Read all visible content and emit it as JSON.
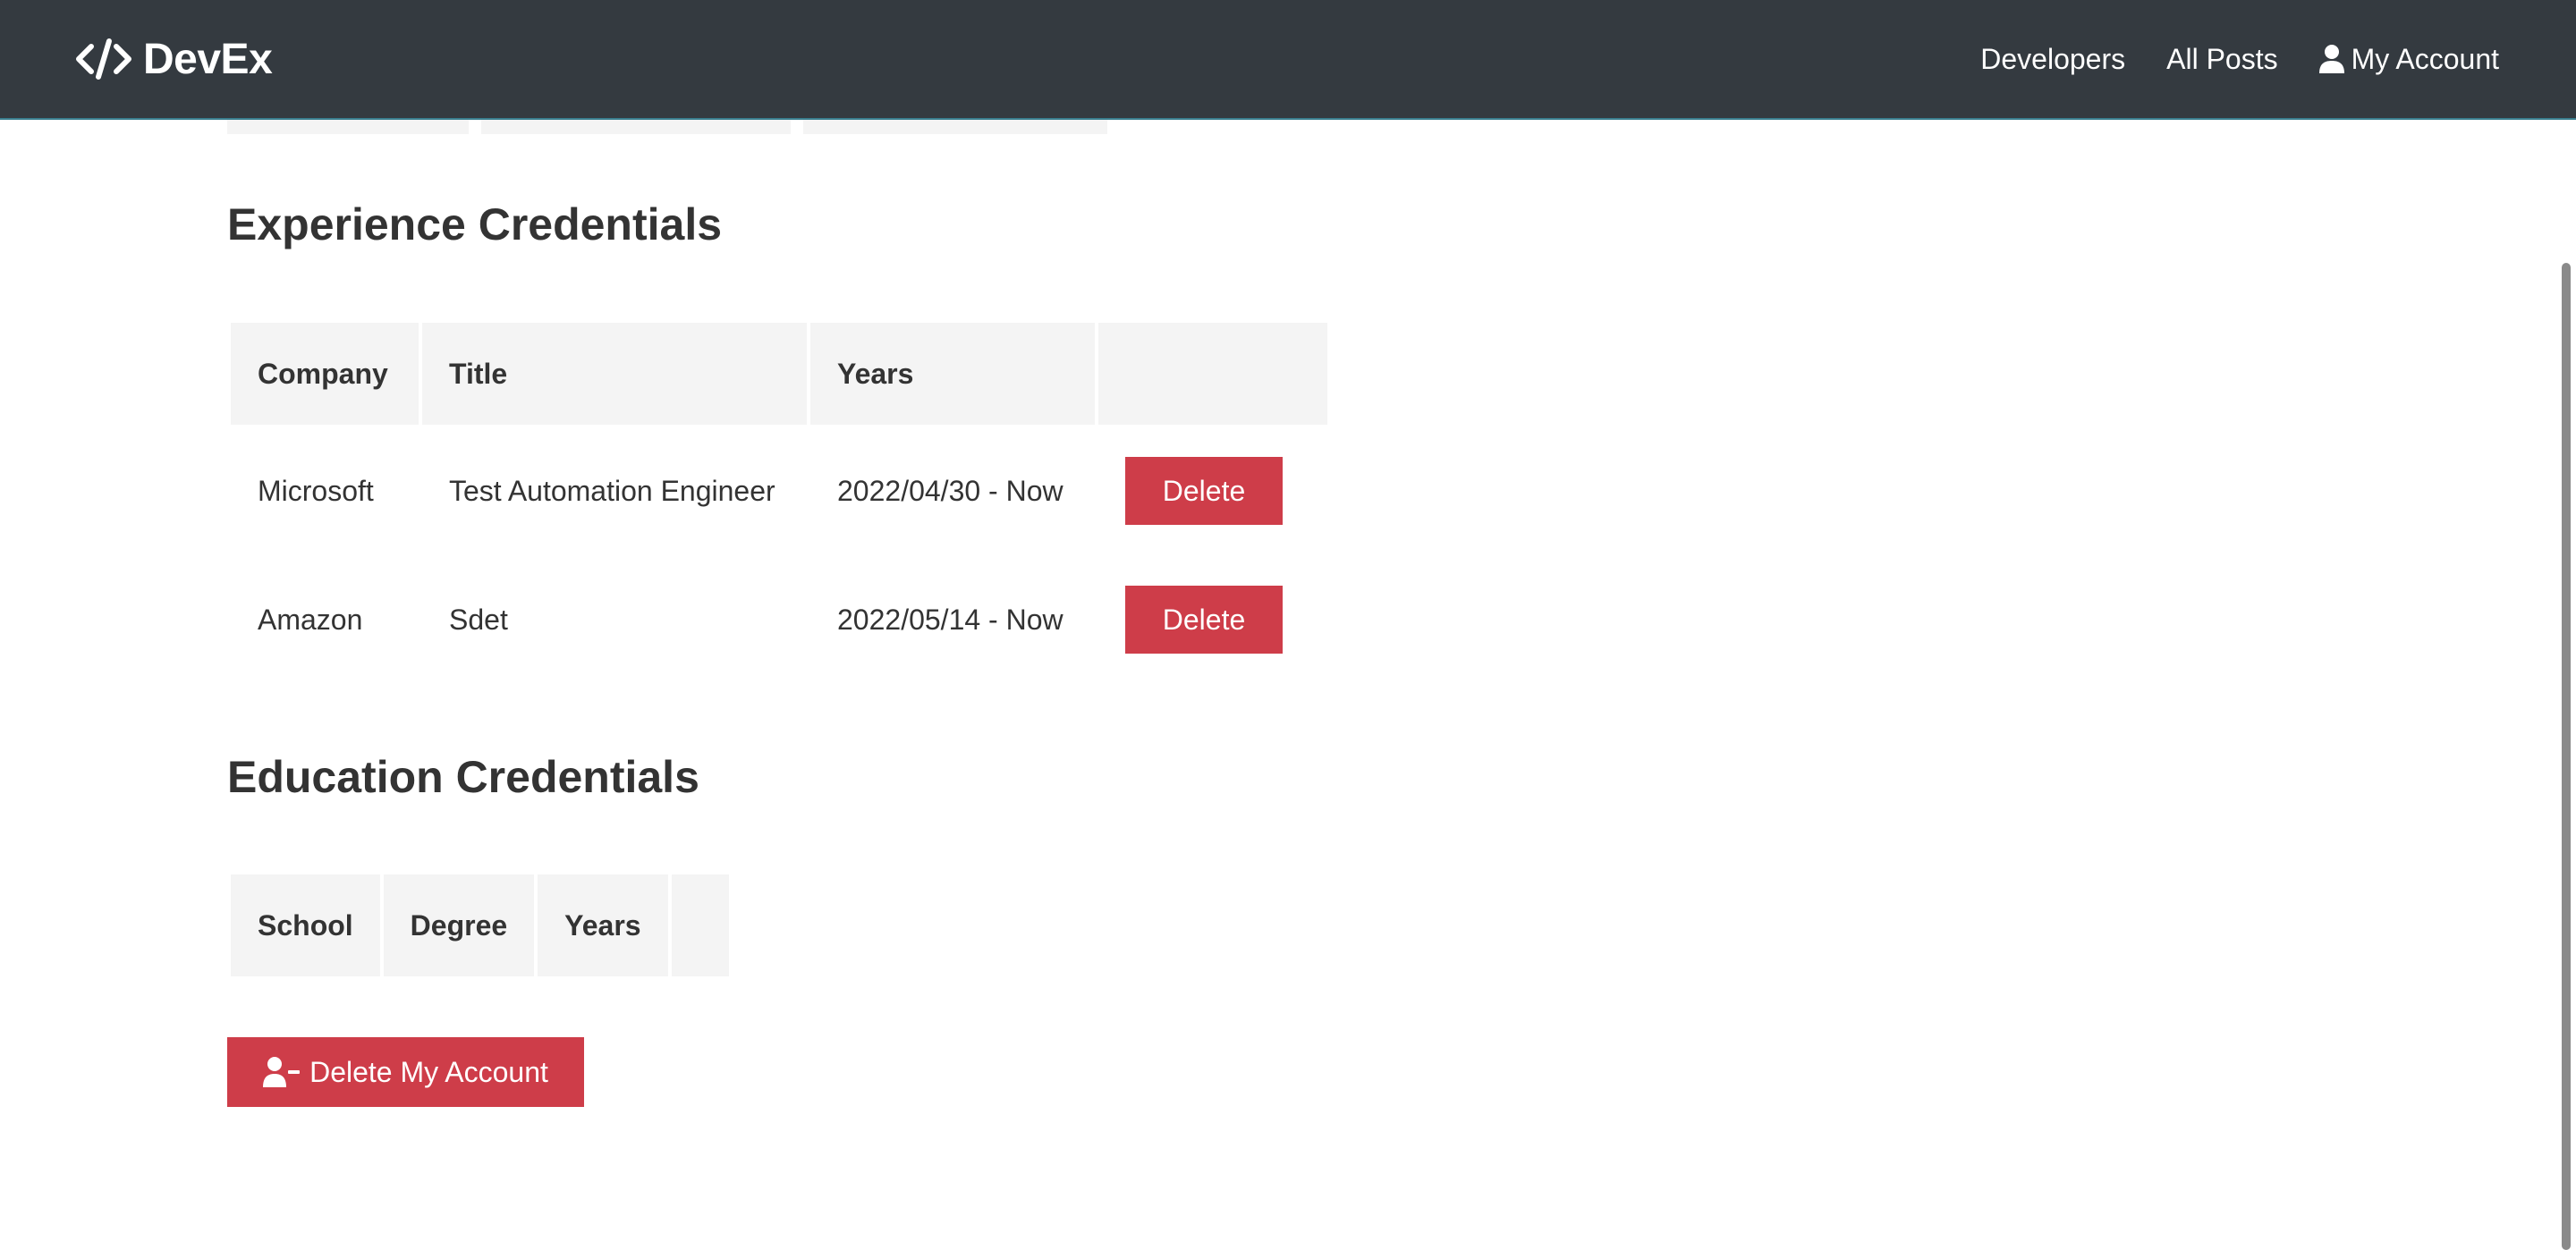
{
  "navbar": {
    "brand": "DevEx",
    "links": [
      "Developers",
      "All Posts",
      "My Account"
    ]
  },
  "experience": {
    "title": "Experience Credentials",
    "headers": [
      "Company",
      "Title",
      "Years",
      ""
    ],
    "rows": [
      {
        "company": "Microsoft",
        "title": "Test Automation Engineer",
        "years": "2022/04/30 - Now",
        "action": "Delete"
      },
      {
        "company": "Amazon",
        "title": "Sdet",
        "years": "2022/05/14 - Now",
        "action": "Delete"
      }
    ]
  },
  "education": {
    "title": "Education Credentials",
    "headers": [
      "School",
      "Degree",
      "Years",
      ""
    ],
    "rows": []
  },
  "delete_account": {
    "label": "Delete My Account"
  },
  "colors": {
    "navbar_bg": "#343a40",
    "danger": "#ce3d49",
    "table_header_bg": "#f4f4f4"
  }
}
